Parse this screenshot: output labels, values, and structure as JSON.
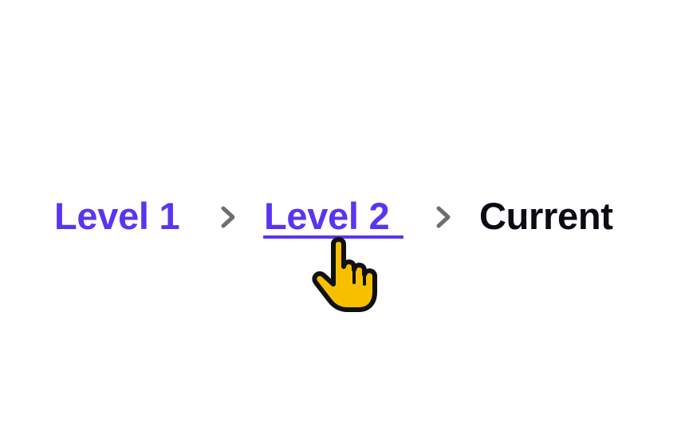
{
  "breadcrumb": {
    "items": [
      {
        "label": "Level 1",
        "state": "link"
      },
      {
        "label": "Level 2",
        "state": "link-hover"
      },
      {
        "label": "Current",
        "state": "current"
      }
    ],
    "separator_icon": "chevron-right-icon"
  },
  "cursor_icon": "hand-pointer-icon",
  "colors": {
    "link": "#5a35f0",
    "current": "#0b0b14",
    "separator": "#6e6e6e",
    "cursor_fill": "#f6c000",
    "cursor_outline": "#101010",
    "background": "#ffffff"
  }
}
